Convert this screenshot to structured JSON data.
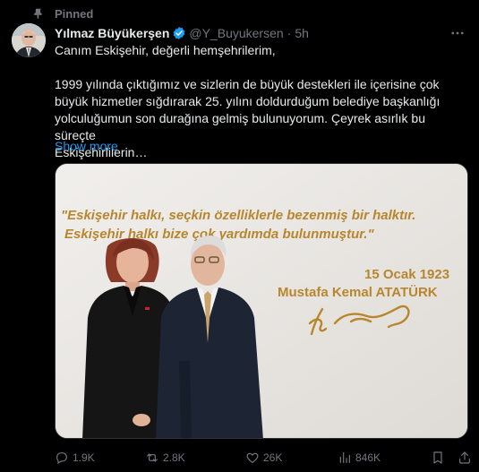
{
  "pinned": {
    "label": "Pinned"
  },
  "author": {
    "display_name": "Yılmaz Büyükerşen",
    "handle": "@Y_Buyukersen",
    "time": "5h"
  },
  "tweet": {
    "line1": "Canım Eskişehir, değerli hemşehrilerim,",
    "line2": "1999 yılında çıktığımız ve sizlerin de büyük destekleri ile içerisine çok",
    "line3": "büyük hizmetler sığdırarak 25. yılını doldurduğum belediye başkanlığı",
    "line4": "yolculuğumun son durağına gelmiş bulunuyorum. Çeyrek asırlık bu süreçte",
    "line5": "Eskişehirlilerin…",
    "show_more": "Show more"
  },
  "media": {
    "quote_line1": "\"Eskişehir halkı, seçkin özelliklerle bezenmiş bir halktır.",
    "quote_line2": "Eskişehir halkı bize çok yardımda bulunmuştur.\"",
    "date": "15 Ocak 1923",
    "attribution": "Mustafa Kemal ATATÜRK"
  },
  "actions": {
    "replies": "1.9K",
    "reposts": "2.8K",
    "likes": "26K",
    "views": "846K"
  },
  "colors": {
    "background": "#000000",
    "text": "#e7e9ea",
    "muted": "#71767b",
    "accent": "#1d9bf0",
    "wall_text": "#b8862e"
  },
  "icons": [
    "pin-icon",
    "verified-icon",
    "more-icon",
    "reply-icon",
    "repost-icon",
    "like-icon",
    "views-icon",
    "bookmark-icon",
    "share-icon"
  ]
}
